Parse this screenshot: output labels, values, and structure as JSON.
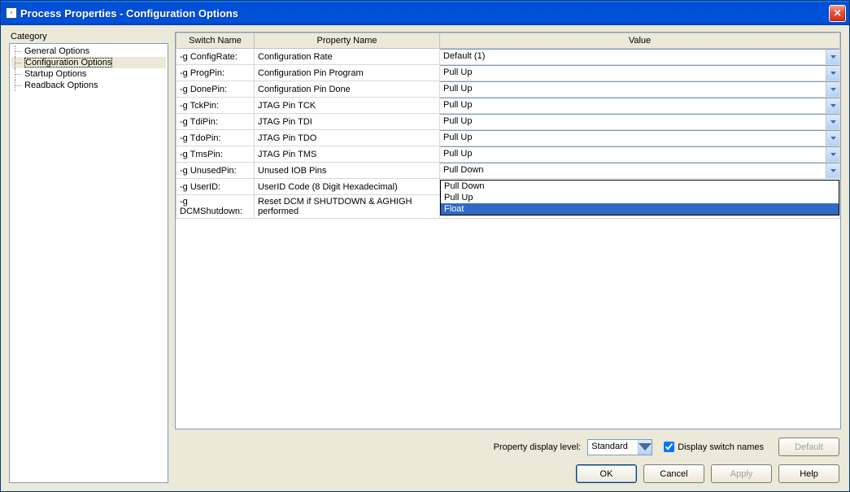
{
  "window": {
    "title": "Process Properties - Configuration Options"
  },
  "sidebar": {
    "label": "Category",
    "items": [
      {
        "label": "General Options",
        "selected": false
      },
      {
        "label": "Configuration Options",
        "selected": true
      },
      {
        "label": "Startup Options",
        "selected": false
      },
      {
        "label": "Readback Options",
        "selected": false
      }
    ]
  },
  "grid": {
    "headers": {
      "switch": "Switch Name",
      "prop": "Property Name",
      "value": "Value"
    },
    "rows": [
      {
        "switch": "-g ConfigRate:",
        "prop": "Configuration Rate",
        "value": "Default (1)",
        "type": "combo"
      },
      {
        "switch": "-g ProgPin:",
        "prop": "Configuration Pin Program",
        "value": "Pull Up",
        "type": "combo"
      },
      {
        "switch": "-g DonePin:",
        "prop": "Configuration Pin Done",
        "value": "Pull Up",
        "type": "combo"
      },
      {
        "switch": "-g TckPin:",
        "prop": "JTAG Pin TCK",
        "value": "Pull Up",
        "type": "combo"
      },
      {
        "switch": "-g TdiPin:",
        "prop": "JTAG Pin TDI",
        "value": "Pull Up",
        "type": "combo"
      },
      {
        "switch": "-g TdoPin:",
        "prop": "JTAG Pin TDO",
        "value": "Pull Up",
        "type": "combo"
      },
      {
        "switch": "-g TmsPin:",
        "prop": "JTAG Pin TMS",
        "value": "Pull Up",
        "type": "combo"
      },
      {
        "switch": "-g UnusedPin:",
        "prop": "Unused IOB Pins",
        "value": "Pull Down",
        "type": "combo",
        "open": true
      },
      {
        "switch": "-g UserID:",
        "prop": "UserID Code (8 Digit Hexadecimal)",
        "value": "",
        "type": "text"
      },
      {
        "switch": "-g DCMShutdown:",
        "prop": "Reset DCM if SHUTDOWN & AGHIGH performed",
        "value": "",
        "type": "check"
      }
    ],
    "dropdown": {
      "options": [
        "Pull Down",
        "Pull Up",
        "Float"
      ],
      "highlight": "Float"
    }
  },
  "footer": {
    "display_level_label": "Property display level:",
    "display_level_value": "Standard",
    "show_switch_label": "Display switch names",
    "show_switch_checked": true,
    "buttons": {
      "default": "Default",
      "ok": "OK",
      "cancel": "Cancel",
      "apply": "Apply",
      "help": "Help"
    }
  }
}
